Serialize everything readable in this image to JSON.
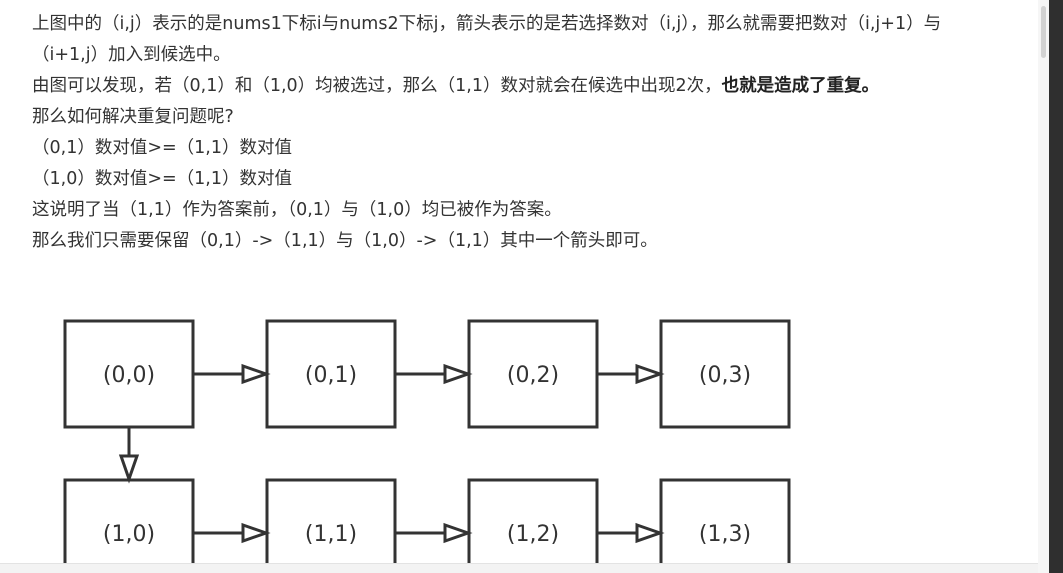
{
  "paragraphs": [
    {
      "parts": [
        {
          "text": "上图中的（i,j）表示的是nums1下标i与nums2下标j，箭头表示的是若选择数对（i,j），那么就需要把数对（i,j+1）与（i+1,j）加入到候选中。",
          "bold": false
        }
      ]
    },
    {
      "parts": [
        {
          "text": "由图可以发现，若（0,1）和（1,0）均被选过，那么（1,1）数对就会在候选中出现2次，",
          "bold": false
        },
        {
          "text": "也就是造成了重复。",
          "bold": true
        }
      ]
    },
    {
      "parts": [
        {
          "text": "那么如何解决重复问题呢?",
          "bold": false
        }
      ]
    },
    {
      "parts": [
        {
          "text": "（0,1）数对值>=（1,1）数对值",
          "bold": false
        }
      ]
    },
    {
      "parts": [
        {
          "text": "（1,0）数对值>=（1,1）数对值",
          "bold": false
        }
      ]
    },
    {
      "parts": [
        {
          "text": "这说明了当（1,1）作为答案前，（0,1）与（1,0）均已被作为答案。",
          "bold": false
        }
      ]
    },
    {
      "parts": [
        {
          "text": "那么我们只需要保留（0,1）->（1,1）与（1,0）->（1,1）其中一个箭头即可。",
          "bold": false
        }
      ]
    }
  ],
  "diagram": {
    "nodes": [
      {
        "id": "0-0",
        "label": "(0,0)",
        "row": 0,
        "col": 0
      },
      {
        "id": "0-1",
        "label": "(0,1)",
        "row": 0,
        "col": 1
      },
      {
        "id": "0-2",
        "label": "(0,2)",
        "row": 0,
        "col": 2
      },
      {
        "id": "0-3",
        "label": "(0,3)",
        "row": 0,
        "col": 3
      },
      {
        "id": "1-0",
        "label": "(1,0)",
        "row": 1,
        "col": 0
      },
      {
        "id": "1-1",
        "label": "(1,1)",
        "row": 1,
        "col": 1
      },
      {
        "id": "1-2",
        "label": "(1,2)",
        "row": 1,
        "col": 2
      },
      {
        "id": "1-3",
        "label": "(1,3)",
        "row": 1,
        "col": 3
      }
    ],
    "edges": [
      {
        "from": "0-0",
        "to": "0-1"
      },
      {
        "from": "0-1",
        "to": "0-2"
      },
      {
        "from": "0-2",
        "to": "0-3"
      },
      {
        "from": "0-0",
        "to": "1-0"
      },
      {
        "from": "1-0",
        "to": "1-1"
      },
      {
        "from": "1-1",
        "to": "1-2"
      },
      {
        "from": "1-2",
        "to": "1-3"
      }
    ]
  },
  "colors": {
    "text": "#333333",
    "stroke": "#333333",
    "background": "#ffffff"
  }
}
